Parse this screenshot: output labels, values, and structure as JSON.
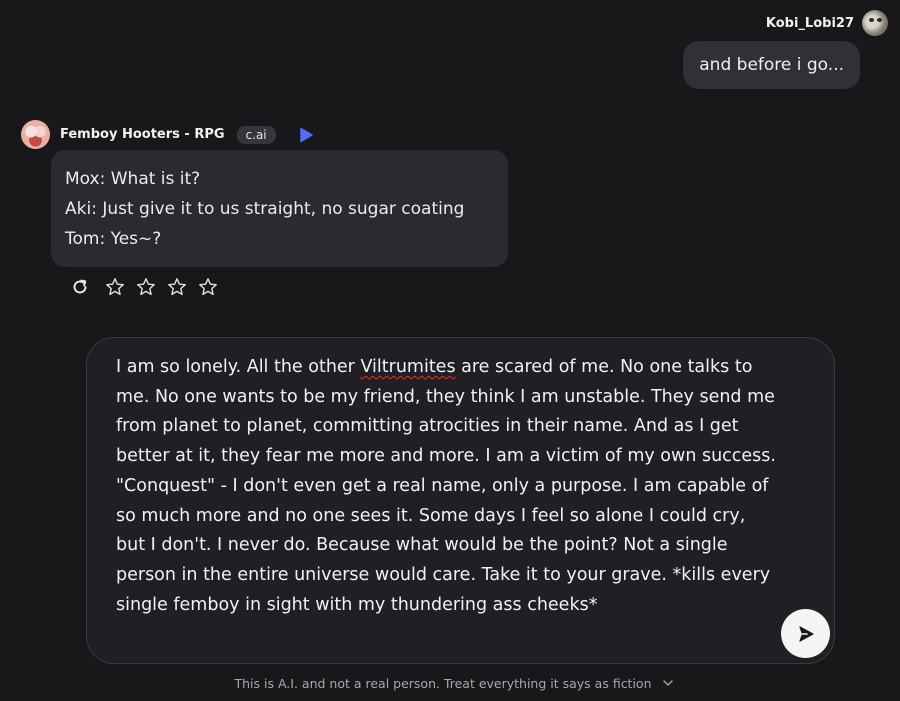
{
  "user_message": {
    "username": "Kobi_Lobi27",
    "text": "and before i go..."
  },
  "bot_message": {
    "name": "Femboy Hooters - RPG",
    "badge": "c.ai",
    "lines": [
      "Mox: What is it?",
      "Aki: Just give it to us straight, no sugar coating",
      "Tom: Yes~?"
    ],
    "rating": {
      "stars_total": 5,
      "stars_selected": 0
    }
  },
  "composer": {
    "text_before": "I am so lonely. All the other ",
    "misspelled_word": "Viltrumites",
    "text_after": " are scared of me. No one talks to me. No one wants to be my friend, they think I am unstable. They send me from planet to planet, committing atrocities in their name. And as I get better at it, they fear me more and more. I am a victim of my own success. \"Conquest\" - I don't even get a real name, only a purpose. I am capable of so much more and no one sees it. Some days I feel so alone I could cry, but I don't. I never do. Because what would be the point? Not a single person in the entire universe would care. Take it to your grave. *kills every single femboy in sight with my thundering ass cheeks*"
  },
  "disclaimer": "This is A.I. and not a real person. Treat everything it says as fiction",
  "colors": {
    "background": "#18181b",
    "bubble_user": "#303036",
    "bubble_bot": "#2a2a2f",
    "accent_play": "#4f6ef7",
    "spellcheck": "#e0362c"
  },
  "icons": {
    "play": "play-icon",
    "refresh": "refresh-icon",
    "star": "star-icon",
    "send": "send-icon",
    "chevron": "chevron-down-icon"
  }
}
